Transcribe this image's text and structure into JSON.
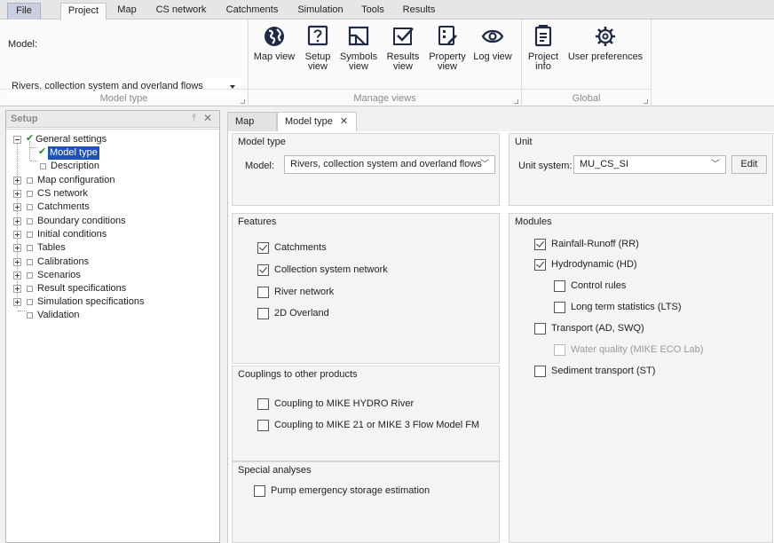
{
  "menu": {
    "tabs": [
      "File",
      "Project",
      "Map",
      "CS network",
      "Catchments",
      "Simulation",
      "Tools",
      "Results"
    ],
    "active": "Project"
  },
  "ribbon": {
    "model_label": "Model:",
    "model_value": "Rivers, collection system and overland flows",
    "groups": {
      "model_type": "Model type",
      "manage_views": "Manage views",
      "global": "Global"
    },
    "buttons": {
      "map_view": "Map view",
      "setup_view": [
        "Setup",
        "view"
      ],
      "symbols_view": [
        "Symbols",
        "view"
      ],
      "results_view": [
        "Results",
        "view"
      ],
      "property_view": [
        "Property",
        "view"
      ],
      "log_view": "Log view",
      "project_info": [
        "Project",
        "info"
      ],
      "user_preferences": "User preferences"
    }
  },
  "setup": {
    "title": "Setup",
    "pin": "⫯",
    "close": "✕",
    "tree": [
      {
        "label": "General settings",
        "level": 0,
        "expander": "minus",
        "check": true
      },
      {
        "label": "Model type",
        "level": 1,
        "check": true,
        "selected": true
      },
      {
        "label": "Description",
        "level": 1,
        "check": false
      },
      {
        "label": "Map configuration",
        "level": 0,
        "expander": "plus",
        "check": false
      },
      {
        "label": "CS network",
        "level": 0,
        "expander": "plus",
        "check": false
      },
      {
        "label": "Catchments",
        "level": 0,
        "expander": "plus",
        "check": false
      },
      {
        "label": "Boundary conditions",
        "level": 0,
        "expander": "plus",
        "check": false
      },
      {
        "label": "Initial conditions",
        "level": 0,
        "expander": "plus",
        "check": false
      },
      {
        "label": "Tables",
        "level": 0,
        "expander": "plus",
        "check": false
      },
      {
        "label": "Calibrations",
        "level": 0,
        "expander": "plus",
        "check": false
      },
      {
        "label": "Scenarios",
        "level": 0,
        "expander": "plus",
        "check": false
      },
      {
        "label": "Result specifications",
        "level": 0,
        "expander": "plus",
        "check": false
      },
      {
        "label": "Simulation specifications",
        "level": 0,
        "expander": "plus",
        "check": false
      },
      {
        "label": "Validation",
        "level": 0,
        "expander": "none",
        "check": false
      }
    ]
  },
  "doc_tabs": {
    "map": "Map",
    "model_type": "Model type",
    "close": "✕"
  },
  "model_type_panel": {
    "title": "Model type",
    "model_label": "Model:",
    "model_value": "Rivers, collection system and overland flows"
  },
  "unit_panel": {
    "title": "Unit",
    "label": "Unit system:",
    "value": "MU_CS_SI",
    "edit": "Edit"
  },
  "features": {
    "title": "Features",
    "items": [
      {
        "label": "Catchments",
        "checked": true
      },
      {
        "label": "Collection system network",
        "checked": true
      },
      {
        "label": "River network",
        "checked": false
      },
      {
        "label": "2D Overland",
        "checked": false
      }
    ]
  },
  "couplings": {
    "title": "Couplings to other products",
    "items": [
      {
        "label": "Coupling to MIKE HYDRO River",
        "checked": false
      },
      {
        "label": "Coupling to MIKE 21 or MIKE 3 Flow Model FM",
        "checked": false
      }
    ]
  },
  "special": {
    "title": "Special analyses",
    "items": [
      {
        "label": "Pump emergency storage estimation",
        "checked": false
      }
    ]
  },
  "modules": {
    "title": "Modules",
    "items": [
      {
        "label": "Rainfall-Runoff (RR)",
        "checked": true,
        "indent": 0
      },
      {
        "label": "Hydrodynamic (HD)",
        "checked": true,
        "indent": 0
      },
      {
        "label": "Control rules",
        "checked": false,
        "indent": 1
      },
      {
        "label": "Long term statistics (LTS)",
        "checked": false,
        "indent": 1
      },
      {
        "label": "Transport (AD, SWQ)",
        "checked": false,
        "indent": 0
      },
      {
        "label": "Water quality (MIKE ECO Lab)",
        "checked": false,
        "indent": 1,
        "disabled": true
      },
      {
        "label": "Sediment transport (ST)",
        "checked": false,
        "indent": 0
      }
    ]
  }
}
